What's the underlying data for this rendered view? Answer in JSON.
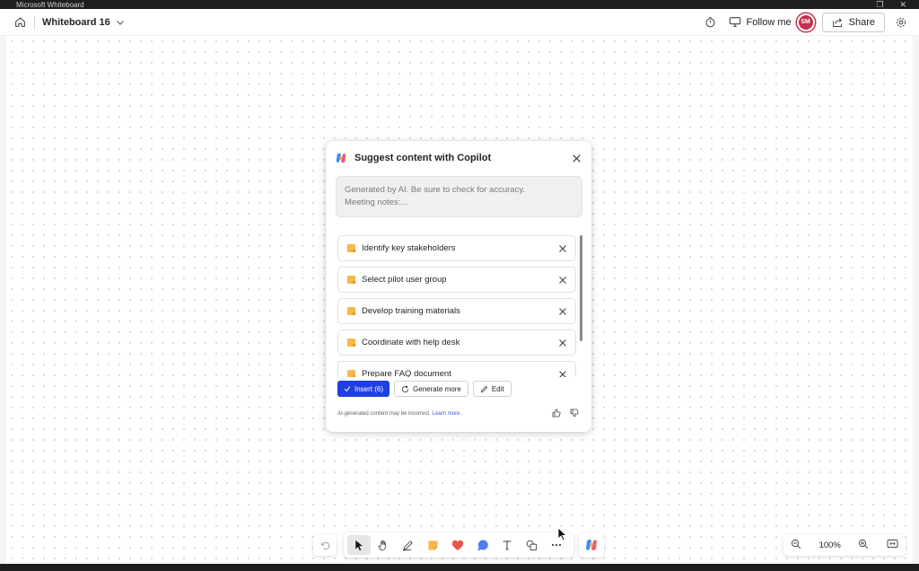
{
  "window": {
    "title": "Microsoft Whiteboard"
  },
  "topbar": {
    "board_name": "Whiteboard 16",
    "follow_label": "Follow me",
    "avatar_initials": "SM",
    "share_label": "Share"
  },
  "copilot": {
    "title": "Suggest content with Copilot",
    "prompt_line1": "Generated by AI. Be sure to check for accuracy.",
    "prompt_line2": "Meeting notes:...",
    "items": [
      {
        "label": "Identify key stakeholders"
      },
      {
        "label": "Select pilot user group"
      },
      {
        "label": "Develop training materials"
      },
      {
        "label": "Coordinate with help desk"
      },
      {
        "label": "Prepare FAQ document"
      }
    ],
    "insert_label": "Insert (6)",
    "generate_label": "Generate more",
    "edit_label": "Edit",
    "disclaimer": "AI-generated content may be incorrect.",
    "learn_more": "Learn more."
  },
  "zoom": {
    "level": "100%"
  },
  "colors": {
    "accent": "#1f3fe0",
    "avatar": "#c4314b",
    "note": "#f7b84b"
  }
}
